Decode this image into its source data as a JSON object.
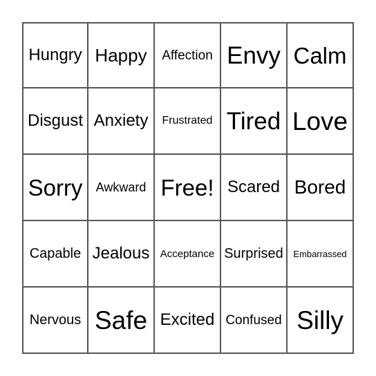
{
  "board": {
    "rows": [
      [
        "Hungry",
        "Happy",
        "Affection",
        "Envy",
        "Calm"
      ],
      [
        "Disgust",
        "Anxiety",
        "Frustrated",
        "Tired",
        "Love"
      ],
      [
        "Sorry",
        "Awkward",
        "Free!",
        "Scared",
        "Bored"
      ],
      [
        "Capable",
        "Jealous",
        "Acceptance",
        "Surprised",
        "Embarrassed"
      ],
      [
        "Nervous",
        "Safe",
        "Excited",
        "Confused",
        "Silly"
      ]
    ]
  }
}
